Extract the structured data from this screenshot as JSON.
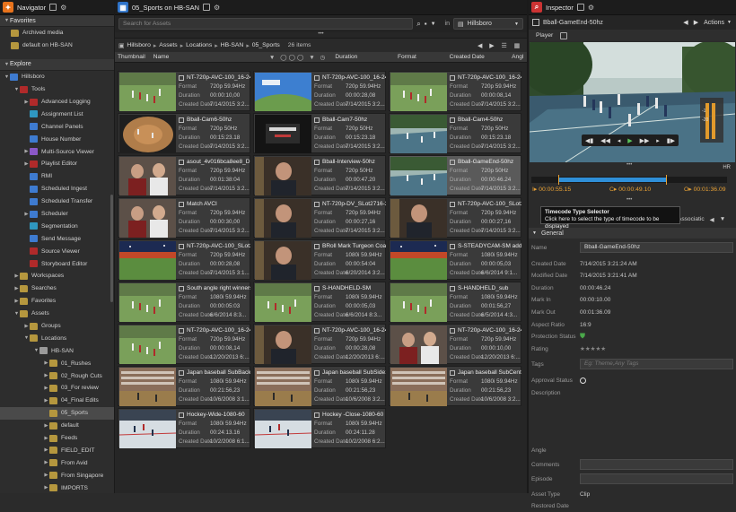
{
  "navigator": {
    "title": "Navigator",
    "favorites_label": "Favorites",
    "favorites": [
      "Archived media",
      "default on HB-SAN"
    ],
    "explore_label": "Explore",
    "tree": [
      {
        "label": "Hillsboro",
        "depth": 0,
        "tri": "▼",
        "icon": "blue"
      },
      {
        "label": "Tools",
        "depth": 1,
        "tri": "▼",
        "icon": "tool"
      },
      {
        "label": "Advanced Logging",
        "depth": 2,
        "tri": "▶",
        "icon": "tool"
      },
      {
        "label": "Assignment List",
        "depth": 2,
        "tri": "",
        "icon": "cyan"
      },
      {
        "label": "Channel Panels",
        "depth": 2,
        "tri": "",
        "icon": "blue"
      },
      {
        "label": "House Number",
        "depth": 2,
        "tri": "",
        "icon": "blue"
      },
      {
        "label": "Multi-Source Viewer",
        "depth": 2,
        "tri": "▶",
        "icon": "purple"
      },
      {
        "label": "Playlist Editor",
        "depth": 2,
        "tri": "▶",
        "icon": "tool"
      },
      {
        "label": "RMI",
        "depth": 2,
        "tri": "",
        "icon": "blue"
      },
      {
        "label": "Scheduled Ingest",
        "depth": 2,
        "tri": "",
        "icon": "blue"
      },
      {
        "label": "Scheduled Transfer",
        "depth": 2,
        "tri": "",
        "icon": "blue"
      },
      {
        "label": "Scheduler",
        "depth": 2,
        "tri": "▶",
        "icon": "blue"
      },
      {
        "label": "Segmentation",
        "depth": 2,
        "tri": "",
        "icon": "cyan"
      },
      {
        "label": "Send Message",
        "depth": 2,
        "tri": "",
        "icon": "blue"
      },
      {
        "label": "Source Viewer",
        "depth": 2,
        "tri": "",
        "icon": "tool"
      },
      {
        "label": "Storyboard Editor",
        "depth": 2,
        "tri": "",
        "icon": "tool"
      },
      {
        "label": "Workspaces",
        "depth": 1,
        "tri": "▶",
        "icon": "folder"
      },
      {
        "label": "Searches",
        "depth": 1,
        "tri": "▶",
        "icon": "folder"
      },
      {
        "label": "Favorites",
        "depth": 1,
        "tri": "▶",
        "icon": "folder"
      },
      {
        "label": "Assets",
        "depth": 1,
        "tri": "▼",
        "icon": "folder"
      },
      {
        "label": "Groups",
        "depth": 2,
        "tri": "▶",
        "icon": "folder"
      },
      {
        "label": "Locations",
        "depth": 2,
        "tri": "▼",
        "icon": "folder"
      },
      {
        "label": "HB-SAN",
        "depth": 3,
        "tri": "▼",
        "icon": "grey"
      },
      {
        "label": "01_Rushes",
        "depth": 4,
        "tri": "▶",
        "icon": "folder"
      },
      {
        "label": "02_Rough Cuts",
        "depth": 4,
        "tri": "▶",
        "icon": "folder"
      },
      {
        "label": "03_For review",
        "depth": 4,
        "tri": "▶",
        "icon": "folder"
      },
      {
        "label": "04_Final Edits",
        "depth": 4,
        "tri": "▶",
        "icon": "folder"
      },
      {
        "label": "05_Sports",
        "depth": 4,
        "tri": "",
        "icon": "folder",
        "selected": true
      },
      {
        "label": "default",
        "depth": 4,
        "tri": "▶",
        "icon": "folder"
      },
      {
        "label": "Feeds",
        "depth": 4,
        "tri": "▶",
        "icon": "folder"
      },
      {
        "label": "FIELD_EDIT",
        "depth": 4,
        "tri": "▶",
        "icon": "folder"
      },
      {
        "label": "From Avid",
        "depth": 4,
        "tri": "▶",
        "icon": "folder"
      },
      {
        "label": "From Singapore",
        "depth": 4,
        "tri": "▶",
        "icon": "folder"
      },
      {
        "label": "IMPORTS",
        "depth": 4,
        "tri": "▶",
        "icon": "folder"
      }
    ]
  },
  "browser": {
    "title": "05_Sports on HB-SAN",
    "search_placeholder": "Search for Assets",
    "in_label": "in",
    "scope": "Hillsboro",
    "breadcrumb": [
      "Hillsboro",
      "Assets",
      "Locations",
      "HB-SAN",
      "05_Sports"
    ],
    "item_count": "26 items",
    "columns": [
      "Thumbnail",
      "Name",
      "Duration",
      "Format",
      "Created Date",
      "Angl"
    ],
    "field_labels": {
      "format": "Format",
      "duration": "Duration",
      "created": "Created Date"
    },
    "assets": [
      {
        "name": "NT-720p-AVC-100_16-24...",
        "format": "720p 59.94Hz",
        "duration": "00:00:10,00",
        "created": "7/14/2015 3:2...",
        "scene": "field",
        "col": 0,
        "row": 0
      },
      {
        "name": "NT-720p-AVC-100_16-24...",
        "format": "720p 59.94Hz",
        "duration": "00:00:28,08",
        "created": "7/14/2015 3:2...",
        "scene": "sky",
        "col": 1,
        "row": 0
      },
      {
        "name": "NT-720p-AVC-100_16-24...",
        "format": "720p 59.94Hz",
        "duration": "00:00:08,14",
        "created": "7/14/2015 3:2...",
        "scene": "field",
        "col": 2,
        "row": 0
      },
      {
        "name": "Bball-Cam6-50hz",
        "format": "720p 50Hz",
        "duration": "00:15:23.18",
        "created": "7/14/2015 3:2...",
        "scene": "fisheye",
        "col": 0,
        "row": 1
      },
      {
        "name": "Bball-Cam7-50hz",
        "format": "720p 50Hz",
        "duration": "00:15:23.18",
        "created": "7/14/2015 3:2...",
        "scene": "dark",
        "col": 1,
        "row": 1
      },
      {
        "name": "Bball-Cam4-50hz",
        "format": "720p 50Hz",
        "duration": "00:15:23.18",
        "created": "7/14/2015 3:2...",
        "scene": "court",
        "col": 2,
        "row": 1
      },
      {
        "name": "asout_4v016bca8ee8_DM...",
        "format": "720p 59.94Hz",
        "duration": "00:01:38:04",
        "created": "7/14/2015 3:2...",
        "scene": "people",
        "col": 0,
        "row": 2
      },
      {
        "name": "Bball-Interview-50hz",
        "format": "720p 50Hz",
        "duration": "00:00:47.20",
        "created": "7/14/2015 3:2...",
        "scene": "person",
        "col": 1,
        "row": 2
      },
      {
        "name": "Bball-GameEnd-50hz",
        "format": "720p 50Hz",
        "duration": "00:00:46.24",
        "created": "7/14/2015 3:2...",
        "scene": "court",
        "col": 2,
        "row": 2,
        "selected": true
      },
      {
        "name": "Match AVCI",
        "format": "720p 59.94Hz",
        "duration": "00:00:30,00",
        "created": "7/14/2015 3:2...",
        "scene": "people",
        "col": 0,
        "row": 3
      },
      {
        "name": "NT-720p-DV_SLot2716-3...",
        "format": "720p 59.94Hz",
        "duration": "00:00:27,16",
        "created": "7/14/2015 3:2...",
        "scene": "person",
        "col": 1,
        "row": 3
      },
      {
        "name": "NT-720p-AVC-100_SLot2...",
        "format": "720p 59.94Hz",
        "duration": "00:00:27,16",
        "created": "7/14/2015 3:2...",
        "scene": "person",
        "col": 2,
        "row": 3
      },
      {
        "name": "NT-720p-AVC-100_SLot28...",
        "format": "720p 59.94Hz",
        "duration": "00:00:28,08",
        "created": "7/14/2015 3:1...",
        "scene": "stadium",
        "col": 0,
        "row": 4
      },
      {
        "name": "BRoll Mark Turgeon Coac...",
        "format": "1080i 59.94Hz",
        "duration": "00:00:54:04",
        "created": "6/20/2014 3:2...",
        "scene": "person",
        "col": 1,
        "row": 4
      },
      {
        "name": "S-STEADYCAM-SM addfo",
        "format": "1080i 59.94Hz",
        "duration": "00:00:05,03",
        "created": "6/6/2014 9:1...",
        "scene": "stadium",
        "col": 2,
        "row": 4
      },
      {
        "name": "South angle right winners",
        "format": "1080i 59.94Hz",
        "duration": "00:00:05:03",
        "created": "6/6/2014 8:3...",
        "scene": "field",
        "col": 0,
        "row": 5
      },
      {
        "name": "S-HANDHELD-SM",
        "format": "1080i 59.94Hz",
        "duration": "00:00:05,03",
        "created": "6/6/2014 8:3...",
        "scene": "field",
        "col": 1,
        "row": 5
      },
      {
        "name": "S-HANDHELD_sub",
        "format": "1080i 59.94Hz",
        "duration": "00:01:56,27",
        "created": "6/5/2014 4:3...",
        "scene": "field",
        "col": 2,
        "row": 5
      },
      {
        "name": "NT-720p-AVC-100_16-24...",
        "format": "720p 59.94Hz",
        "duration": "00:00:08,14",
        "created": "12/20/2013 6:...",
        "scene": "field",
        "col": 0,
        "row": 6
      },
      {
        "name": "NT-720p-AVC-100_16-24...",
        "format": "720p 59.94Hz",
        "duration": "00:00:28,08",
        "created": "12/20/2013 6:...",
        "scene": "person",
        "col": 1,
        "row": 6
      },
      {
        "name": "NT-720p-AVC-100_16-24...",
        "format": "720p 59.94Hz",
        "duration": "00:00:10,00",
        "created": "12/20/2013 6:...",
        "scene": "people",
        "col": 2,
        "row": 6
      },
      {
        "name": "Japan baseball SubBackn...",
        "format": "1080i 59.94Hz",
        "duration": "00:21:56,23",
        "created": "10/6/2008 3:1...",
        "scene": "crowd",
        "col": 0,
        "row": 7
      },
      {
        "name": "Japan baseball SubSide10...",
        "format": "1080i 59.94Hz",
        "duration": "00:21:56,23",
        "created": "10/6/2008 3:2...",
        "scene": "crowd",
        "col": 1,
        "row": 7
      },
      {
        "name": "Japan baseball SubCenter...",
        "format": "1080i 59.94Hz",
        "duration": "00:21:56,23",
        "created": "10/6/2008 3:2...",
        "scene": "crowd",
        "col": 2,
        "row": 7
      },
      {
        "name": "Hockey-Wide-1080-60",
        "format": "1080i 59.94Hz",
        "duration": "00:24:13.16",
        "created": "10/2/2008 6:1...",
        "scene": "ice",
        "col": 0,
        "row": 8
      },
      {
        "name": "Hockey -Close-1080-60",
        "format": "1080i 59.94Hz",
        "duration": "00:24:11.28",
        "created": "10/2/2008 6:2...",
        "scene": "ice",
        "col": 1,
        "row": 8
      }
    ]
  },
  "inspector": {
    "title": "Inspector",
    "asset_name": "Bball-GameEnd-50hz",
    "actions_label": "Actions",
    "player_tab": "Player",
    "hr_label": "HR",
    "timecode_in": "I",
    "timecode_in_value": "00:00:55.15",
    "timecode_c": "C",
    "timecode_c_value": "00:00:49.10",
    "timecode_o": "O",
    "timecode_o_value": "00:01:36.09",
    "tooltip_title": "Timecode Type Selector",
    "tooltip_text": "Click here to select the type of timecode to be displayed",
    "tab_fragment_1": "nces",
    "tab_fragment_2": "Associatic",
    "section_general": "General",
    "props": [
      {
        "label": "Name",
        "value": "Bball-GameEnd-50hz",
        "boxed": true
      },
      {
        "label": "Created Date",
        "value": "7/14/2015 3:21:24 AM"
      },
      {
        "label": "Modified Date",
        "value": "7/14/2015 3:21:41 AM"
      },
      {
        "label": "Duration",
        "value": "00:00:46.24"
      },
      {
        "label": "Mark In",
        "value": "00:00:10.00"
      },
      {
        "label": "Mark Out",
        "value": "00:01:36.09"
      },
      {
        "label": "Aspect Ratio",
        "value": "16:9"
      },
      {
        "label": "Protection Status",
        "value": ""
      },
      {
        "label": "Rating",
        "value": "★★★★★"
      },
      {
        "label": "Tags",
        "value": "Eg: Theme,Any Tags",
        "boxed": true,
        "placeholder": true
      },
      {
        "label": "Approval Status",
        "value": ""
      },
      {
        "label": "Description",
        "value": ""
      }
    ],
    "props_lower": [
      {
        "label": "Angle",
        "value": ""
      },
      {
        "label": "Comments",
        "value": "",
        "boxed": true
      },
      {
        "label": "Episode",
        "value": "",
        "boxed": true
      },
      {
        "label": "Asset Type",
        "value": "Clip"
      },
      {
        "label": "Restored Date",
        "value": ""
      }
    ],
    "colors": {
      "accent": "#e8a135",
      "timeline": "#2f8fd8",
      "protected": "#4aa84a"
    }
  }
}
